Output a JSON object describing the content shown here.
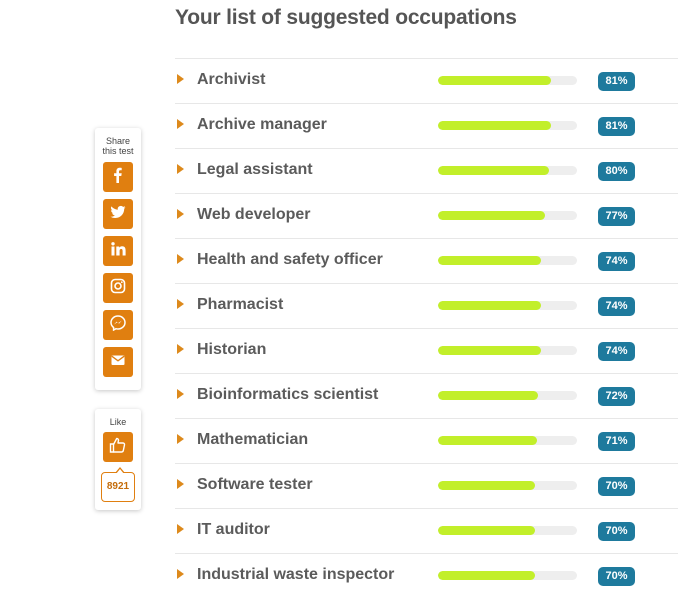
{
  "title": "Your list of suggested occupations",
  "occupations": [
    {
      "name": "Archivist",
      "score": 81,
      "score_label": "81%"
    },
    {
      "name": "Archive manager",
      "score": 81,
      "score_label": "81%"
    },
    {
      "name": "Legal assistant",
      "score": 80,
      "score_label": "80%"
    },
    {
      "name": "Web developer",
      "score": 77,
      "score_label": "77%"
    },
    {
      "name": "Health and safety officer",
      "score": 74,
      "score_label": "74%"
    },
    {
      "name": "Pharmacist",
      "score": 74,
      "score_label": "74%"
    },
    {
      "name": "Historian",
      "score": 74,
      "score_label": "74%"
    },
    {
      "name": "Bioinformatics scientist",
      "score": 72,
      "score_label": "72%"
    },
    {
      "name": "Mathematician",
      "score": 71,
      "score_label": "71%"
    },
    {
      "name": "Software tester",
      "score": 70,
      "score_label": "70%"
    },
    {
      "name": "IT auditor",
      "score": 70,
      "score_label": "70%"
    },
    {
      "name": "Industrial waste inspector",
      "score": 70,
      "score_label": "70%"
    }
  ],
  "share": {
    "label_line1": "Share",
    "label_line2": "this test",
    "buttons": [
      {
        "icon": "facebook-icon"
      },
      {
        "icon": "twitter-icon"
      },
      {
        "icon": "linkedin-icon"
      },
      {
        "icon": "instagram-icon"
      },
      {
        "icon": "messenger-icon"
      },
      {
        "icon": "email-icon"
      }
    ]
  },
  "like": {
    "label": "Like",
    "icon": "thumbs-up-icon",
    "count": "8921"
  },
  "colors": {
    "accent_orange": "#e07f10",
    "bar_fill": "#c2ef2a",
    "badge_bg": "#1e7a9d",
    "text": "#555555"
  }
}
